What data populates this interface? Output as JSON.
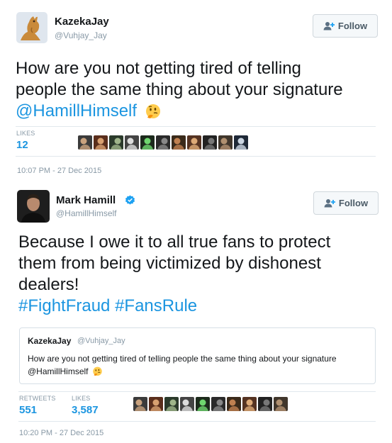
{
  "tweet1": {
    "author_name": "KazekaJay",
    "author_handle": "@Vuhjay_Jay",
    "follow_label": "Follow",
    "text_line1": "How are you not getting tired of telling",
    "text_line2": "people the same thing about your signature",
    "mention": "@HamillHimself",
    "emoji": "thinking-face",
    "likes_label": "LIKES",
    "likes_count": "12",
    "timestamp": "10:07 PM - 27 Dec 2015"
  },
  "tweet2": {
    "author_name": "Mark Hamill",
    "author_handle": "@HamillHimself",
    "verified": true,
    "follow_label": "Follow",
    "text_line1": "Because I owe it to all true fans to protect",
    "text_line2": "them from being victimized by dishonest",
    "text_line3": "dealers!",
    "hashtag1": "#FightFraud",
    "hashtag2": "#FansRule",
    "quote": {
      "author_name": "KazekaJay",
      "author_handle": "@Vuhjay_Jay",
      "text_line1": "How are you not getting tired of telling people the same thing about your signature",
      "text_line2": "@HamillHimself"
    },
    "retweets_label": "RETWEETS",
    "retweets_count": "551",
    "likes_label": "LIKES",
    "likes_count": "3,587",
    "timestamp": "10:20 PM - 27 Dec 2015"
  },
  "colors": {
    "link": "#1b95e0",
    "muted": "#8899a6",
    "text": "#14171a",
    "divider": "#e1e8ed",
    "verified": "#1da1f2"
  },
  "tweet1_likers": [
    "liker-avatar",
    "liker-avatar",
    "liker-avatar",
    "liker-avatar",
    "liker-avatar",
    "liker-avatar",
    "liker-avatar",
    "liker-avatar",
    "liker-avatar",
    "liker-avatar",
    "liker-avatar"
  ],
  "tweet2_likers": [
    "liker-avatar",
    "liker-avatar",
    "liker-avatar",
    "liker-avatar",
    "liker-avatar",
    "liker-avatar",
    "liker-avatar",
    "liker-avatar",
    "liker-avatar",
    "liker-avatar"
  ]
}
